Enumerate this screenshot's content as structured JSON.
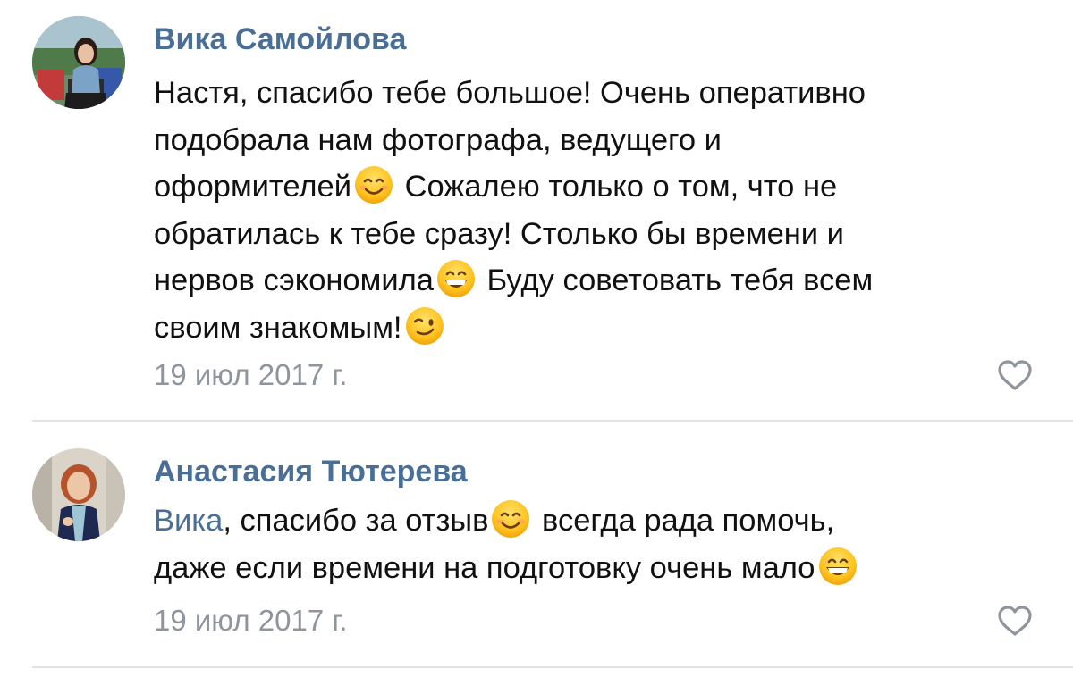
{
  "comments": [
    {
      "author": "Вика Самойлова",
      "avatar_icon": "user-photo-avatar",
      "lines": [
        [
          "Настя, спасибо тебе большое! Очень оперативно"
        ],
        [
          "подобрала нам фотографа, ведущего и"
        ],
        [
          "оформителей",
          "smiling-face-emoji",
          " Сожалею только о том, что не"
        ],
        [
          "обратилась к тебе сразу! Столько бы времени и"
        ],
        [
          "нервов сэкономила",
          "grinning-face-emoji",
          " Буду советовать тебя всем"
        ],
        [
          "своим знакомым!",
          "winking-face-emoji"
        ]
      ],
      "date": "19 июл 2017 г.",
      "like_icon": "heart-outline-icon"
    },
    {
      "author": "Анастасия Тютерева",
      "avatar_icon": "user-photo-avatar",
      "mention": "Вика",
      "line1_rest": ", спасибо за отзыв",
      "line1_after_emoji": " всегда рада помочь,",
      "line2": "даже если времени на подготовку очень мало",
      "date": "19 июл 2017 г.",
      "like_icon": "heart-outline-icon"
    }
  ],
  "colors": {
    "author": "#4a6f96",
    "text": "#111111",
    "date": "#8f959c",
    "divider": "#e2e3e6",
    "like": "#8f959c"
  },
  "text": {
    "c1_l1": "Настя, спасибо тебе большое! Очень оперативно",
    "c1_l2": "подобрала нам фотографа, ведущего и",
    "c1_l3a": "оформителей",
    "c1_l3b": " Сожалею только о том, что не",
    "c1_l4": "обратилась к тебе сразу! Столько бы времени и",
    "c1_l5a": "нервов сэкономила",
    "c1_l5b": " Буду советовать тебя всем",
    "c1_l6": "своим знакомым!"
  }
}
